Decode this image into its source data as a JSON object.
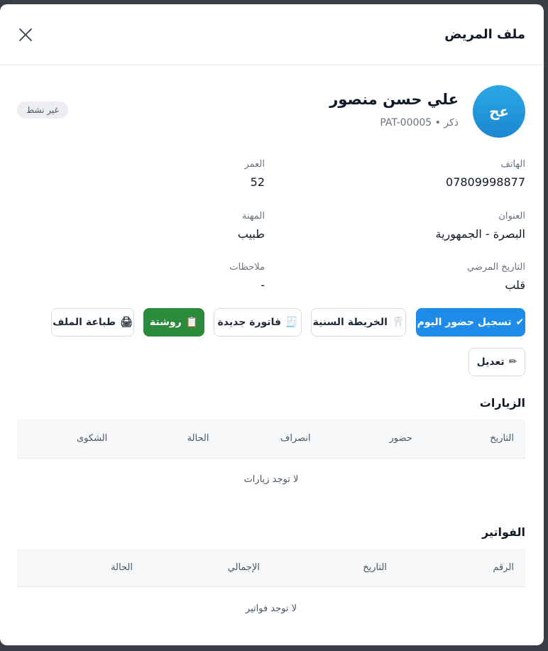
{
  "modal": {
    "title": "ملف المريض"
  },
  "patient": {
    "initials": "عح",
    "name": "علي حسن منصور",
    "subline": "PAT-00005 • ذكر",
    "status_badge": "غير نشط"
  },
  "fields": {
    "phone": {
      "label": "الهاتف",
      "value": "07809998877"
    },
    "age": {
      "label": "العمر",
      "value": "52"
    },
    "address": {
      "label": "العنوان",
      "value": "البصرة - الجمهورية"
    },
    "job": {
      "label": "المهنة",
      "value": "طبيب"
    },
    "history": {
      "label": "التاريخ المرضي",
      "value": "قلب"
    },
    "notes": {
      "label": "ملاحظات",
      "value": "-"
    }
  },
  "actions": {
    "checkin": {
      "icon": "✔",
      "label": "تسجيل حضور اليوم"
    },
    "dental_chart": {
      "icon": "🦷",
      "label": "الخريطة السنية"
    },
    "new_invoice": {
      "icon": "🧾",
      "label": "فاتورة جديدة"
    },
    "prescription": {
      "icon": "📋",
      "label": "روشتة"
    },
    "print": {
      "icon": "🖨",
      "label": "طباعة الملف"
    },
    "edit": {
      "icon": "✏",
      "label": "تعديل"
    }
  },
  "visits": {
    "title": "الزيارات",
    "columns": [
      "التاريخ",
      "حضور",
      "انصراف",
      "الحالة",
      "الشكوى"
    ],
    "empty_text": "لا توجد زيارات"
  },
  "invoices": {
    "title": "الفواتير",
    "columns": [
      "الرقم",
      "التاريخ",
      "الإجمالي",
      "الحالة"
    ],
    "empty_text": "لا توجد فواتير"
  },
  "colors": {
    "primary": "#1f8be8",
    "success": "#2c8a3c",
    "avatar": "#1b87cf"
  }
}
